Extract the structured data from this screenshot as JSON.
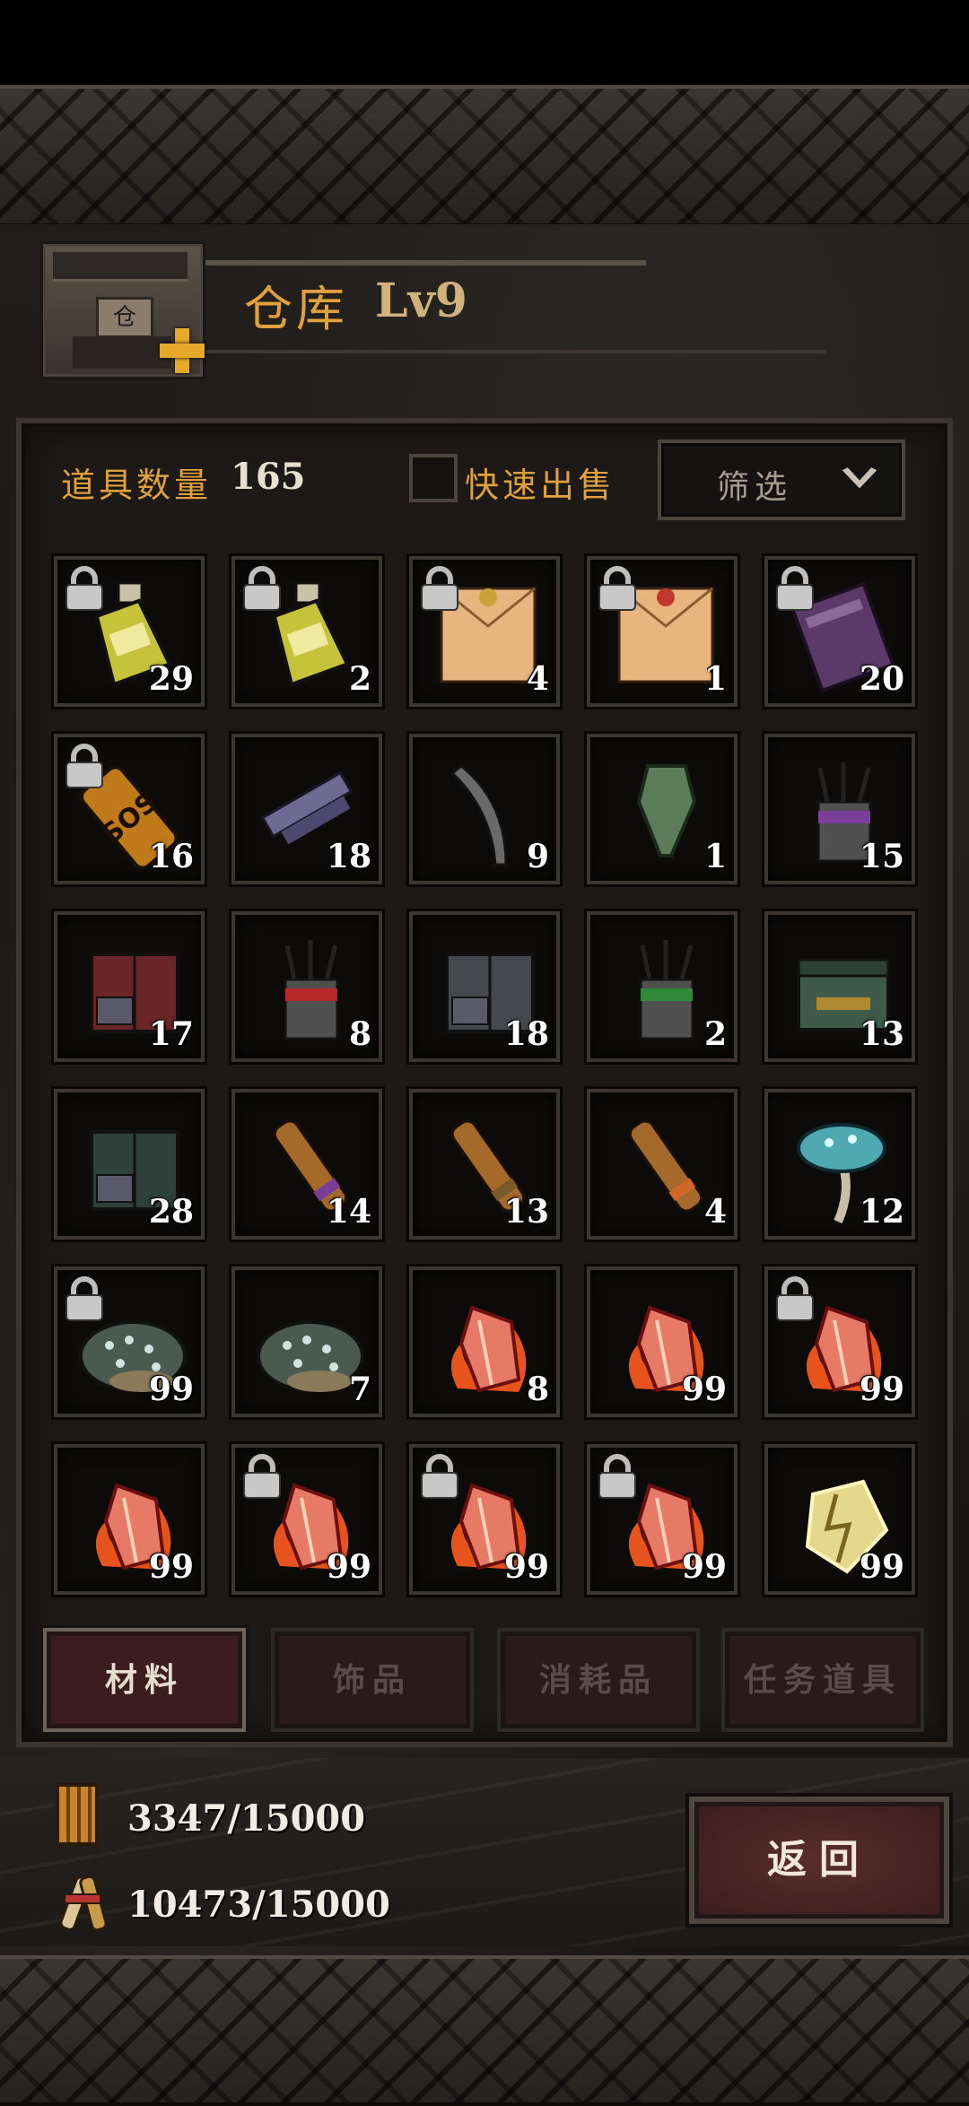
{
  "header": {
    "title": "仓库",
    "level": "Lv9",
    "building_icon": "warehouse-building-icon",
    "upgrade_icon": "plus-icon"
  },
  "toolbar": {
    "count_label": "道具数量",
    "count_value": "165",
    "quick_sell_label": "快速出售",
    "quick_sell_checked": false,
    "filter_label": "筛选"
  },
  "items": [
    {
      "icon": "yellow-potion-bottle-icon",
      "qty": "29",
      "locked": true
    },
    {
      "icon": "yellow-potion-bottle-icon",
      "qty": "2",
      "locked": true
    },
    {
      "icon": "sealed-letter-icon",
      "qty": "4",
      "locked": true
    },
    {
      "icon": "sealed-letter-red-icon",
      "qty": "1",
      "locked": true
    },
    {
      "icon": "purple-book-icon",
      "qty": "20",
      "locked": true
    },
    {
      "icon": "sos-bottle-icon",
      "qty": "16",
      "locked": true
    },
    {
      "icon": "purple-chain-icon",
      "qty": "18",
      "locked": false
    },
    {
      "icon": "curved-blade-icon",
      "qty": "9",
      "locked": false
    },
    {
      "icon": "green-tool-icon",
      "qty": "1",
      "locked": false
    },
    {
      "icon": "purple-quiver-icon",
      "qty": "15",
      "locked": false
    },
    {
      "icon": "red-crate-icon",
      "qty": "17",
      "locked": false
    },
    {
      "icon": "red-quiver-icon",
      "qty": "8",
      "locked": false
    },
    {
      "icon": "grey-crate-icon",
      "qty": "18",
      "locked": false
    },
    {
      "icon": "green-quiver-icon",
      "qty": "2",
      "locked": false
    },
    {
      "icon": "green-chest-icon",
      "qty": "13",
      "locked": false
    },
    {
      "icon": "green-crate-icon",
      "qty": "28",
      "locked": false
    },
    {
      "icon": "purple-scroll-icon",
      "qty": "14",
      "locked": false
    },
    {
      "icon": "brown-scroll-icon",
      "qty": "13",
      "locked": false
    },
    {
      "icon": "orange-scroll-icon",
      "qty": "4",
      "locked": false
    },
    {
      "icon": "blue-mushroom-icon",
      "qty": "12",
      "locked": false
    },
    {
      "icon": "crystal-ore-icon",
      "qty": "99",
      "locked": true
    },
    {
      "icon": "crystal-ore-icon",
      "qty": "7",
      "locked": false
    },
    {
      "icon": "fire-crystal-icon",
      "qty": "8",
      "locked": false
    },
    {
      "icon": "fire-crystal-icon",
      "qty": "99",
      "locked": false
    },
    {
      "icon": "fire-crystal-icon",
      "qty": "99",
      "locked": true
    },
    {
      "icon": "fire-crystal-icon",
      "qty": "99",
      "locked": false
    },
    {
      "icon": "fire-crystal-icon",
      "qty": "99",
      "locked": true
    },
    {
      "icon": "fire-crystal-icon",
      "qty": "99",
      "locked": true
    },
    {
      "icon": "fire-crystal-icon",
      "qty": "99",
      "locked": true
    },
    {
      "icon": "lightning-crystal-icon",
      "qty": "99",
      "locked": false
    }
  ],
  "tabs": [
    {
      "label": "材料",
      "active": true
    },
    {
      "label": "饰品",
      "active": false
    },
    {
      "label": "消耗品",
      "active": false
    },
    {
      "label": "任务道具",
      "active": false
    }
  ],
  "resources": [
    {
      "icon": "wood-bundle-icon",
      "text": "3347/15000"
    },
    {
      "icon": "scroll-bundle-icon",
      "text": "10473/15000"
    }
  ],
  "back_label": "返回",
  "colors": {
    "accent": "#e0a03e",
    "tab_active": "#3c1c1f",
    "button": "#4a2424"
  }
}
